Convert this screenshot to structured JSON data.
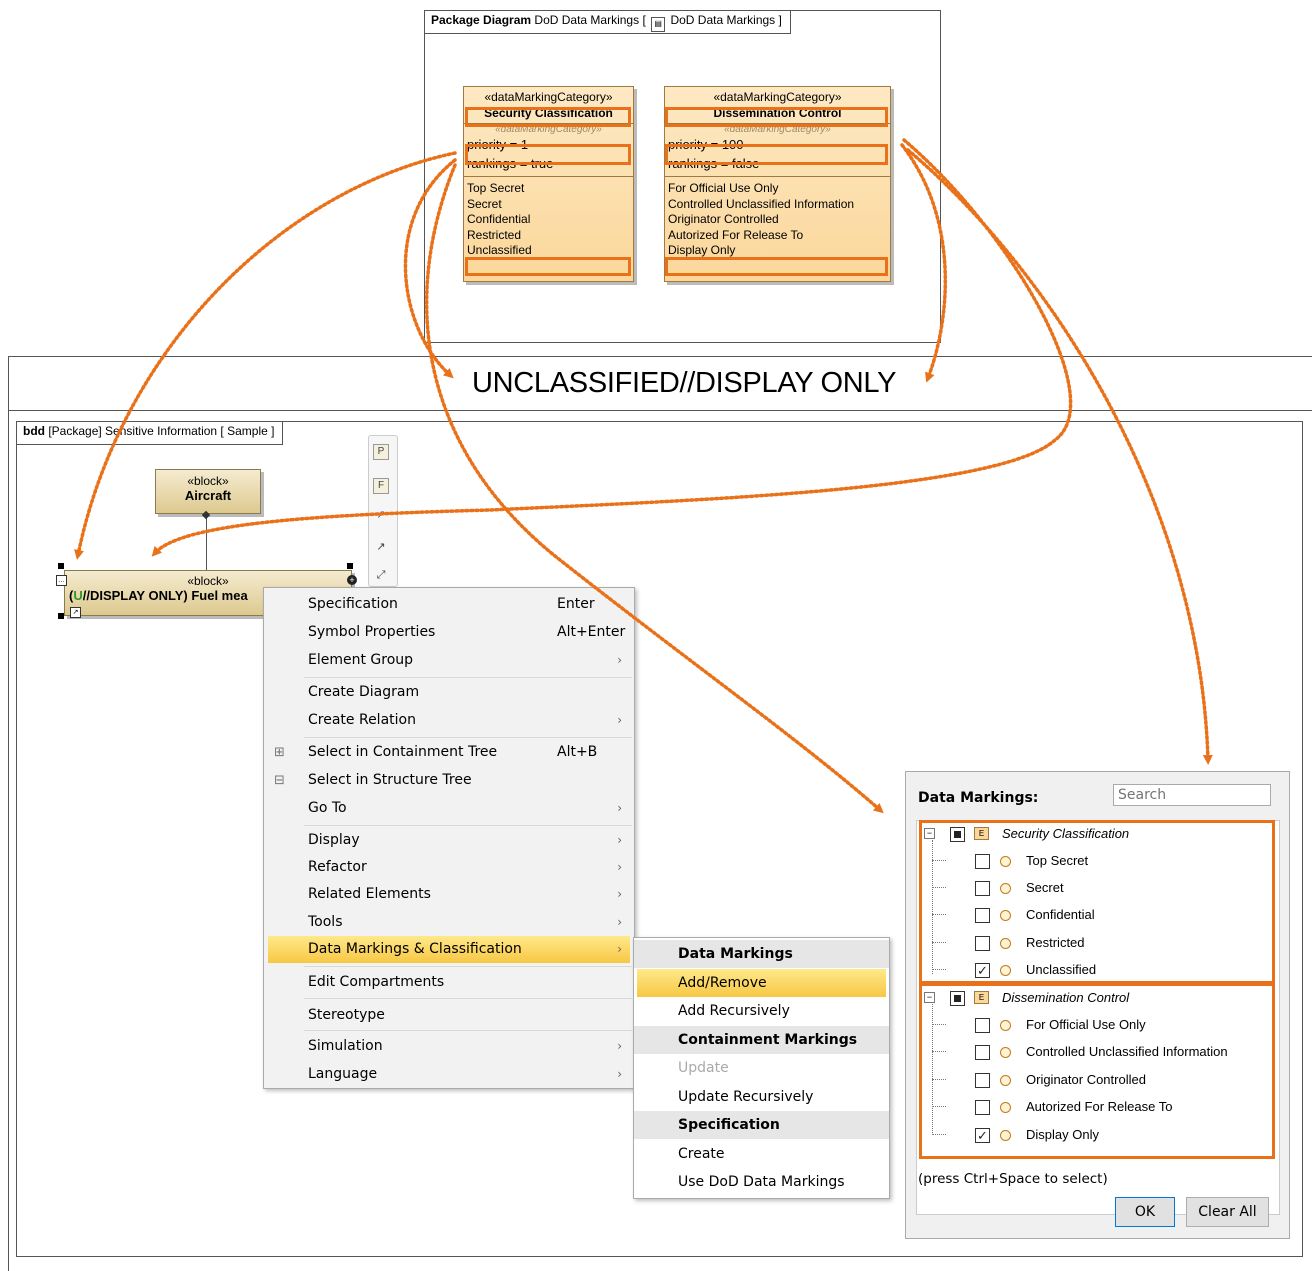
{
  "package_diagram": {
    "tab_kind": "Package Diagram",
    "tab_name": "DoD Data Markings [",
    "tab_ref": "DoD Data Markings ]",
    "categories": [
      {
        "stereotype": "«dataMarkingCategory»",
        "name": "Security Classification",
        "stereotype2": "«dataMarkingCategory»",
        "priority": "priority = 1",
        "rankings": "rankings = true",
        "literals": [
          "Top Secret",
          "Secret",
          "Confidential",
          "Restricted",
          "Unclassified"
        ]
      },
      {
        "stereotype": "«dataMarkingCategory»",
        "name": "Dissemination Control",
        "stereotype2": "«dataMarkingCategory»",
        "priority": "priority = 100",
        "rankings": "rankings = false",
        "literals": [
          "For Official Use Only",
          "Controlled Unclassified Information",
          "Originator Controlled",
          "Autorized For Release To",
          "Display Only"
        ]
      }
    ]
  },
  "banner": "UNCLASSIFIED//DISPLAY ONLY",
  "bdd": {
    "tab_kind": "bdd",
    "tab_rest": "[Package] Sensitive Information [ Sample ]",
    "aircraft_stereotype": "«block»",
    "aircraft_name": "Aircraft",
    "fuel_stereotype": "«block»",
    "fuel_prefix": "(",
    "fuel_u": "U",
    "fuel_name": "//DISPLAY ONLY) Fuel mea",
    "toolbar": [
      "P",
      "F"
    ]
  },
  "context_menu": {
    "items": [
      {
        "label": "Specification",
        "shortcut": "Enter"
      },
      {
        "label": "Symbol Properties",
        "shortcut": "Alt+Enter"
      },
      {
        "label": "Element Group",
        "arrow": "›"
      },
      {
        "label": "Create Diagram"
      },
      {
        "label": "Create Relation",
        "arrow": "›"
      },
      {
        "label": "Select in Containment Tree",
        "shortcut": "Alt+B"
      },
      {
        "label": "Select in Structure Tree"
      },
      {
        "label": "Go To",
        "arrow": "›"
      },
      {
        "label": "Display",
        "arrow": "›"
      },
      {
        "label": "Refactor",
        "arrow": "›"
      },
      {
        "label": "Related Elements",
        "arrow": "›"
      },
      {
        "label": "Tools",
        "arrow": "›"
      },
      {
        "label": "Data Markings & Classification",
        "arrow": "›"
      },
      {
        "label": "Edit Compartments"
      },
      {
        "label": "Stereotype"
      },
      {
        "label": "Simulation",
        "arrow": "›"
      },
      {
        "label": "Language",
        "arrow": "›"
      }
    ]
  },
  "submenu": {
    "items": [
      {
        "label": "Data Markings"
      },
      {
        "label": "Add/Remove"
      },
      {
        "label": "Add Recursively"
      },
      {
        "label": "Containment Markings"
      },
      {
        "label": "Update"
      },
      {
        "label": "Update Recursively"
      },
      {
        "label": "Specification"
      },
      {
        "label": "Create"
      },
      {
        "label": "Use DoD Data Markings"
      }
    ]
  },
  "data_markings_panel": {
    "title": "Data Markings:",
    "search_placeholder": "Search",
    "groups": [
      {
        "name": "Security Classification",
        "items": [
          {
            "label": "Top Secret",
            "checked": false
          },
          {
            "label": "Secret",
            "checked": false
          },
          {
            "label": "Confidential",
            "checked": false
          },
          {
            "label": "Restricted",
            "checked": false
          },
          {
            "label": "Unclassified",
            "checked": true
          }
        ]
      },
      {
        "name": "Dissemination Control",
        "items": [
          {
            "label": "For Official Use Only",
            "checked": false
          },
          {
            "label": "Controlled Unclassified Information",
            "checked": false
          },
          {
            "label": "Originator Controlled",
            "checked": false
          },
          {
            "label": "Autorized For Release To",
            "checked": false
          },
          {
            "label": "Display Only",
            "checked": true
          }
        ]
      }
    ],
    "hint": "(press Ctrl+Space to select)",
    "ok_label": "OK",
    "clear_label": "Clear All"
  },
  "colors": {
    "highlight": "#e8711a",
    "menu_active": "#f7c744",
    "category_fill": "#fbd79a"
  }
}
